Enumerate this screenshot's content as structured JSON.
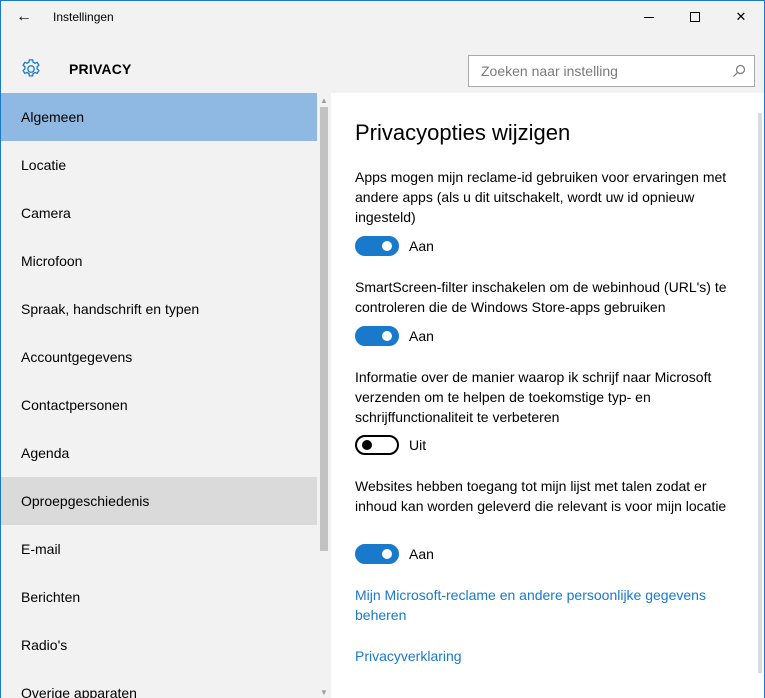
{
  "window": {
    "title": "Instellingen",
    "back_icon": "arrow-left-icon",
    "minimize_icon": "minimize-icon",
    "maximize_icon": "maximize-icon",
    "close_icon": "close-icon",
    "close_glyph": "✕",
    "back_glyph": "←"
  },
  "header": {
    "icon": "gear-icon",
    "title": "PRIVACY",
    "search_placeholder": "Zoeken naar instelling",
    "search_icon": "search-icon"
  },
  "sidebar": {
    "items": [
      {
        "label": "Algemeen",
        "state": "selected"
      },
      {
        "label": "Locatie",
        "state": "normal"
      },
      {
        "label": "Camera",
        "state": "normal"
      },
      {
        "label": "Microfoon",
        "state": "normal"
      },
      {
        "label": "Spraak, handschrift en typen",
        "state": "normal"
      },
      {
        "label": "Accountgegevens",
        "state": "normal"
      },
      {
        "label": "Contactpersonen",
        "state": "normal"
      },
      {
        "label": "Agenda",
        "state": "normal"
      },
      {
        "label": "Oproepgeschiedenis",
        "state": "hovered"
      },
      {
        "label": "E-mail",
        "state": "normal"
      },
      {
        "label": "Berichten",
        "state": "normal"
      },
      {
        "label": "Radio's",
        "state": "normal"
      },
      {
        "label": "Overige apparaten",
        "state": "normal"
      }
    ]
  },
  "main": {
    "title": "Privacyopties wijzigen",
    "options": [
      {
        "text": "Apps mogen mijn reclame-id gebruiken voor ervaringen met andere apps (als u dit uitschakelt, wordt uw id opnieuw ingesteld)",
        "toggle_on": true,
        "toggle_label": "Aan"
      },
      {
        "text": "SmartScreen-filter inschakelen om de webinhoud (URL's) te controleren die de Windows Store-apps gebruiken",
        "toggle_on": true,
        "toggle_label": "Aan"
      },
      {
        "text": "Informatie over de manier waarop ik schrijf naar Microsoft verzenden om te helpen de toekomstige typ- en schrijffunctionaliteit te verbeteren",
        "toggle_on": false,
        "toggle_label": "Uit"
      },
      {
        "text": "Websites hebben toegang tot mijn lijst met talen zodat er inhoud kan worden geleverd die relevant is voor mijn locatie",
        "toggle_on": true,
        "toggle_label": "Aan"
      }
    ],
    "links": [
      "Mijn Microsoft-reclame en andere persoonlijke gegevens beheren",
      "Privacyverklaring"
    ]
  },
  "colors": {
    "accent": "#1979ca",
    "selected_nav": "#8fb8e3",
    "hovered_nav": "#dadada",
    "sidebar_bg": "#f2f2f2"
  }
}
